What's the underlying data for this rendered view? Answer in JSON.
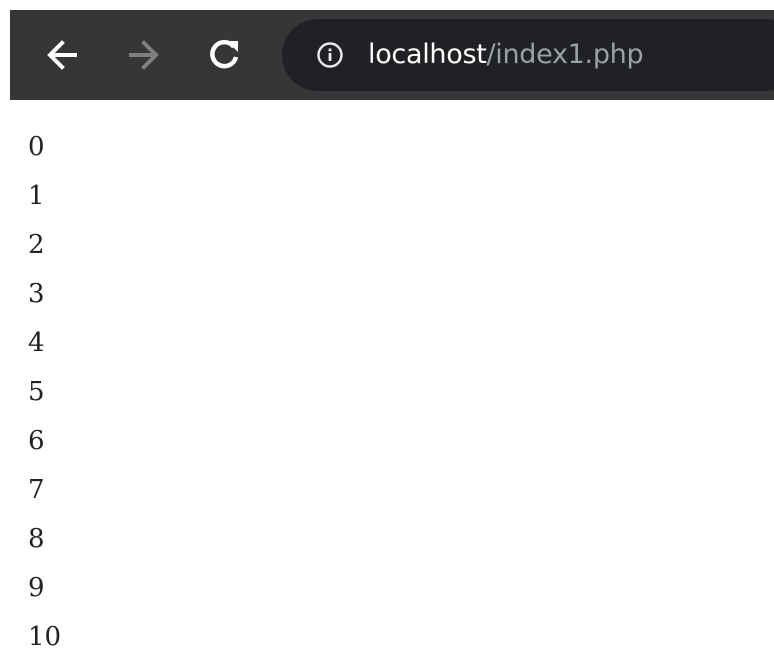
{
  "browser": {
    "url_host": "localhost",
    "url_path": "/index1.php",
    "icons": {
      "back": "arrow-left-icon",
      "forward": "arrow-right-icon",
      "reload": "reload-icon",
      "site_info": "info-icon"
    },
    "colors": {
      "toolbar": "#353638",
      "omnibox": "#202124",
      "url_host": "#ffffff",
      "url_path": "#9aa0a6",
      "forward_disabled": "#7c7e80"
    }
  },
  "page": {
    "lines": [
      "0",
      "1",
      "2",
      "3",
      "4",
      "5",
      "6",
      "7",
      "8",
      "9",
      "10"
    ]
  }
}
